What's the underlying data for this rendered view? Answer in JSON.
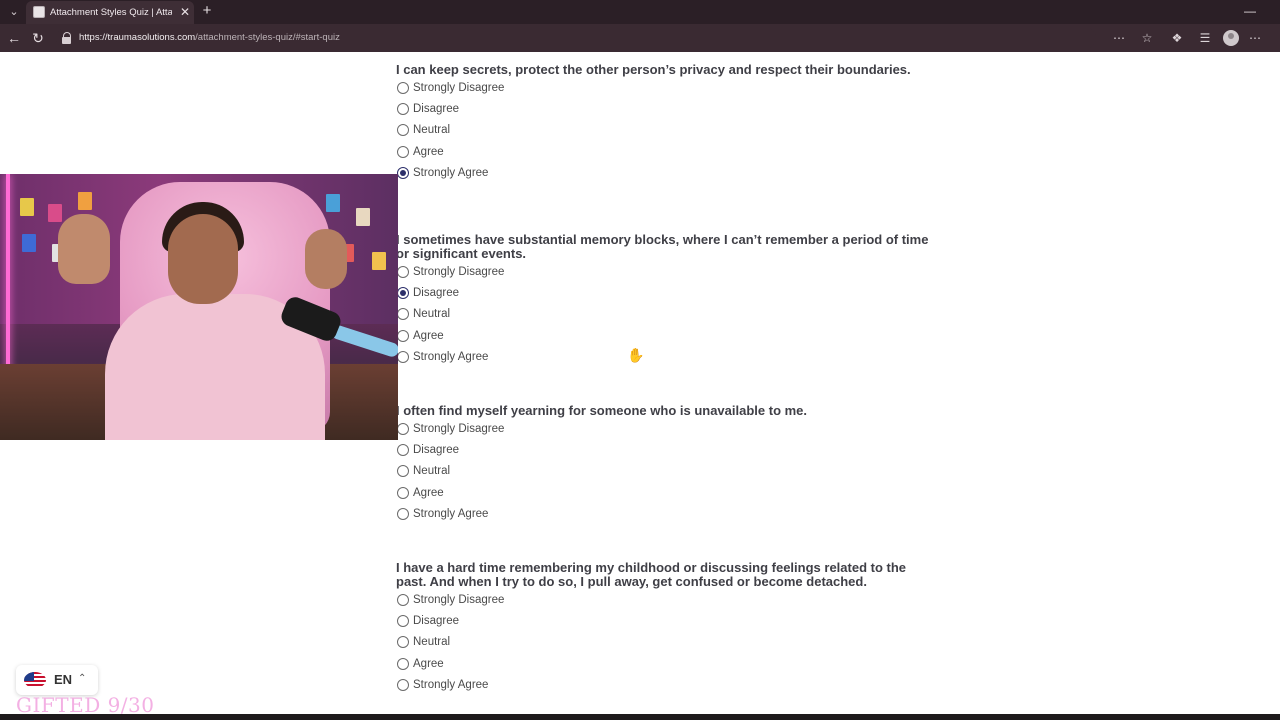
{
  "browser": {
    "tab_title": "Attachment Styles Quiz | Attachm",
    "url_host": "https://traumasolutions.com",
    "url_path": "/attachment-styles-quiz/#start-quiz"
  },
  "options": [
    "Strongly Disagree",
    "Disagree",
    "Neutral",
    "Agree",
    "Strongly Agree"
  ],
  "questions": [
    {
      "text": "I can keep secrets, protect the other person’s privacy and respect their boundaries.",
      "selected": "Strongly Agree"
    },
    {
      "text": "I sometimes have substantial memory blocks, where I can’t remember a period of time or significant events.",
      "selected": "Disagree"
    },
    {
      "text": "I often find myself yearning for someone who is unavailable to me.",
      "selected": null
    },
    {
      "text": "I have a hard time remembering my childhood or discussing feelings related to the past. And when I try to do so, I pull away, get confused or become detached.",
      "selected": null
    }
  ],
  "language": {
    "code": "EN"
  },
  "overlay": {
    "gifted_text": "GIFTED 9/30"
  },
  "colors": {
    "radio_selected": "#2d2f6b",
    "question_text": "#3f3f46",
    "chrome_bg": "#3a2a32"
  }
}
